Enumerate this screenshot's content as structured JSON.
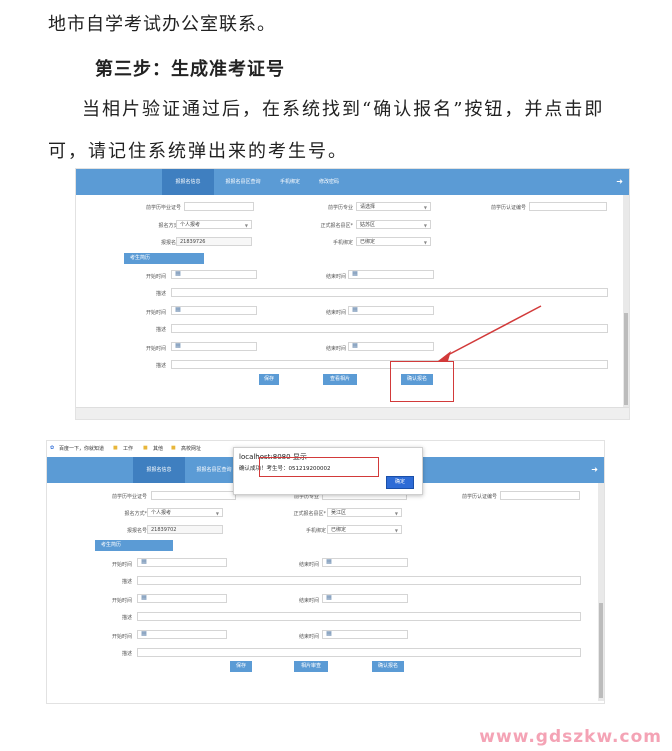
{
  "doc": {
    "line1": "地市自学考试办公室联系。",
    "step_heading": "第三步：生成准考证号",
    "para_line1": "当相片验证通过后，在系统找到“确认报名”按钮，并点击即",
    "para_line2": "可，请记住系统弹出来的考生号。"
  },
  "app": {
    "tabs": [
      "报报名信息",
      "报报名县区查询",
      "手机绑定",
      "修改密码"
    ],
    "exit_icon": "exit-icon",
    "labels": {
      "id_no": "前学历毕业证号",
      "major": "前学历专业",
      "cert_no": "前学历认证编号",
      "reg_method": "报名方式*",
      "reg_area": "正式报名县区*",
      "reg_no": "报报名号",
      "phone": "手机绑定",
      "start": "开始时间",
      "end": "结束时间",
      "desc": "描述"
    },
    "values": {
      "major_shot1": "请选择",
      "method": "个人报考",
      "area_shot1": "姑苏区",
      "area_shot2": "吴江区",
      "phone": "已绑定",
      "reg_no_shot1": "21839726",
      "reg_no_shot2": "21839702"
    },
    "section_title": "考生简历",
    "buttons_shot1": [
      "保存",
      "查看相片",
      "确认报名"
    ],
    "buttons_shot2": [
      "保存",
      "相片审查",
      "确认报名"
    ]
  },
  "browser": {
    "bookmarks": [
      "百度一下，你就知道",
      "工作",
      "其他",
      "高校网址"
    ]
  },
  "dialog": {
    "title": "localhost:8080 显示",
    "message": "确认成功！考生号：051219200002",
    "ok": "确定"
  },
  "watermark": "www.gdszkw.com",
  "colors": {
    "nav": "#5b9bd5",
    "highlight": "#d23a3a",
    "ok_button": "#2d6bd6"
  }
}
